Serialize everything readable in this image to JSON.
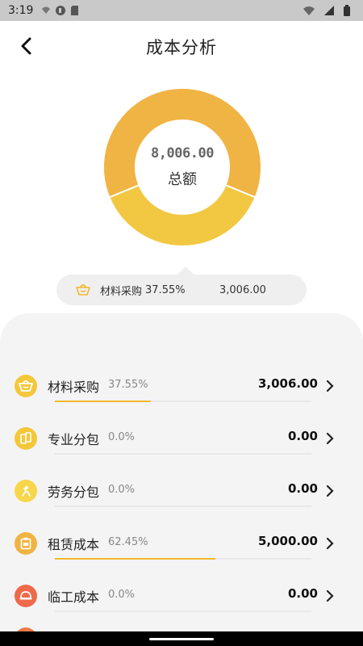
{
  "status_bar": {
    "time": "3:19"
  },
  "header": {
    "title": "成本分析"
  },
  "donut": {
    "total_value": "8,006.00",
    "total_label": "总额",
    "segments": [
      {
        "name": "材料采购",
        "value": 3006.0,
        "color": "#f2c842"
      },
      {
        "name": "租赁成本",
        "value": 5000.0,
        "color": "#f0b444"
      }
    ]
  },
  "tooltip": {
    "name": "材料采购",
    "percent": "37.55%",
    "amount": "3,006.00"
  },
  "items": [
    {
      "name": "材料采购",
      "percent": "37.55%",
      "amount": "3,006.00",
      "fraction": 0.3755,
      "icon": "basket-icon",
      "color": "#f3c73a"
    },
    {
      "name": "专业分包",
      "percent": "0.0%",
      "amount": "0.00",
      "fraction": 0,
      "icon": "cards-icon",
      "color": "#f3c73a"
    },
    {
      "name": "劳务分包",
      "percent": "0.0%",
      "amount": "0.00",
      "fraction": 0,
      "icon": "worker-icon",
      "color": "#f7d64a"
    },
    {
      "name": "租赁成本",
      "percent": "62.45%",
      "amount": "5,000.00",
      "fraction": 0.6245,
      "icon": "clipboard-icon",
      "color": "#f0b444"
    },
    {
      "name": "临工成本",
      "percent": "0.0%",
      "amount": "0.00",
      "fraction": 0,
      "icon": "helmet-icon",
      "color": "#ee6a4a"
    }
  ]
}
